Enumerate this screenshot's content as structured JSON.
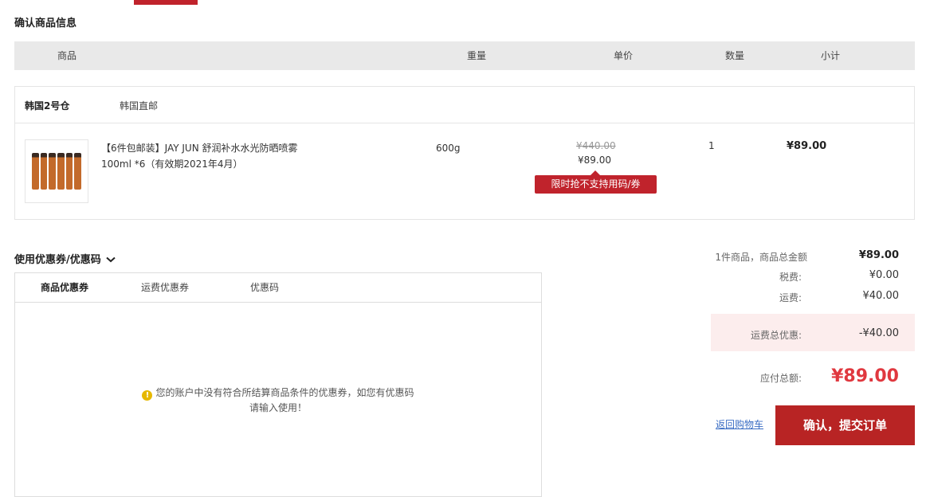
{
  "section_title": "确认商品信息",
  "table_header": {
    "product": "商品",
    "weight": "重量",
    "unit_price": "单价",
    "quantity": "数量",
    "subtotal": "小计"
  },
  "warehouse": {
    "name": "韩国2号仓",
    "shipping_type": "韩国直邮"
  },
  "item": {
    "name_line1": "【6件包邮装】JAY JUN 舒润补水水光防晒喷雾",
    "name_line2": "100ml *6（有效期2021年4月）",
    "weight": "600g",
    "original_price": "¥440.00",
    "price": "¥89.00",
    "promo_tag": "限时抢不支持用码/券",
    "quantity": "1",
    "subtotal": "¥89.00",
    "thumb_icon": "product-bottles-image"
  },
  "coupon": {
    "title": "使用优惠券/优惠码",
    "toggle_icon": "chevron-down-icon",
    "tabs": [
      "商品优惠券",
      "运费优惠券",
      "优惠码"
    ],
    "notice_line1": "您的账户中没有符合所结算商品条件的优惠券，如您有优惠码",
    "notice_line2": "请输入使用！",
    "notice_icon": "warning-icon"
  },
  "summary": {
    "items_label": "1件商品，商品总金额",
    "items_value": "¥89.00",
    "tax_label": "税费:",
    "tax_value": "¥0.00",
    "shipping_label": "运费:",
    "shipping_value": "¥40.00",
    "shipping_discount_label": "运费总优惠:",
    "shipping_discount_value": "-¥40.00",
    "total_label": "应付总额:",
    "total_value": "¥89.00"
  },
  "actions": {
    "back_label": "返回购物车",
    "submit_label": "确认，提交订单"
  },
  "colors": {
    "accent": "#c0232c",
    "total": "#e0383f",
    "link": "#3b6ec4"
  }
}
